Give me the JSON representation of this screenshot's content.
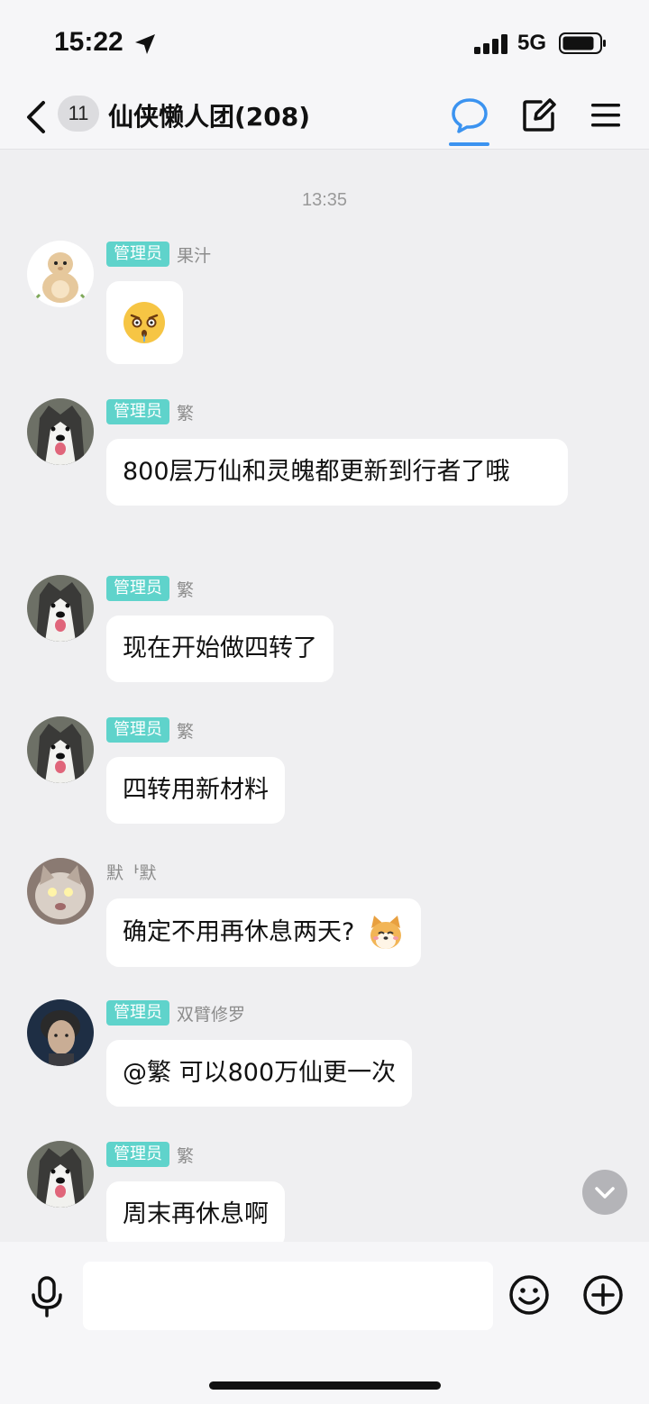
{
  "status_bar": {
    "time": "15:22",
    "network": "5G",
    "icons": [
      "location-arrow-icon",
      "signal-bars-icon",
      "battery-icon"
    ]
  },
  "nav": {
    "unread_count": "11",
    "title": "仙侠懒人团(208)",
    "icons": [
      "back-icon",
      "chat-bubble-icon",
      "edit-icon",
      "menu-icon"
    ],
    "accent_color": "#3b93f0"
  },
  "chat": {
    "time_divider": "13:35",
    "messages": [
      {
        "role": "管理员",
        "sender": "果汁",
        "text": "",
        "emoji": "shocked-face-sticker",
        "avatar": "cartoon-dino-avatar"
      },
      {
        "role": "管理员",
        "sender": "繁",
        "text": "800层万仙和灵魄都更新到行者了哦",
        "avatar": "husky-avatar"
      },
      {
        "role": "管理员",
        "sender": "繁",
        "text": "现在开始做四转了",
        "avatar": "husky-avatar"
      },
      {
        "role": "管理员",
        "sender": "繁",
        "text": "四转用新材料",
        "avatar": "husky-avatar"
      },
      {
        "role": "",
        "sender": "默ᅡ默",
        "text": "确定不用再休息两天?",
        "emoji": "shiba-face-sticker",
        "avatar": "cat-avatar"
      },
      {
        "role": "管理员",
        "sender": "双臂修罗",
        "text": "@繁 可以800万仙更一次",
        "avatar": "man-portrait-avatar"
      },
      {
        "role": "管理员",
        "sender": "繁",
        "text": "周末再休息啊",
        "avatar": "husky-avatar"
      }
    ],
    "role_badge_color": "#5fd3cb"
  },
  "input_bar": {
    "placeholder": "",
    "icons": [
      "microphone-icon",
      "emoji-face-icon",
      "add-circle-icon"
    ]
  }
}
